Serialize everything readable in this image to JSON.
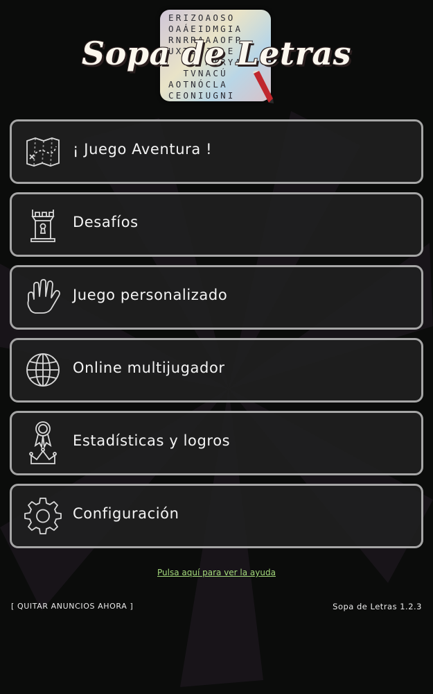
{
  "logo": {
    "grid_rows": [
      "ERIZOAOSO",
      "OAÁEIDMGIA",
      "RNRRAAAOFP",
      "UXTBVJ  E",
      "  T  MTRYA",
      "  TVNACÚ",
      "AOTNÓCLA",
      "CEONIUGNI"
    ],
    "title": "Sopa de Letras"
  },
  "menu": {
    "items": [
      {
        "label": "¡ Juego Aventura !",
        "icon": "map-icon"
      },
      {
        "label": "Desafíos",
        "icon": "tower-icon"
      },
      {
        "label": "Juego personalizado",
        "icon": "hand-icon"
      },
      {
        "label": "Online multijugador",
        "icon": "globe-icon"
      },
      {
        "label": "Estadísticas y logros",
        "icon": "medal-crown-icon"
      },
      {
        "label": "Configuración",
        "icon": "gear-icon"
      }
    ]
  },
  "footer": {
    "help_link": "Pulsa aquí para ver la ayuda",
    "remove_ads": "[ QUITAR ANUNCIOS AHORA ]",
    "version": "Sopa de Letras 1.2.3"
  },
  "colors": {
    "background": "#0b0c0b",
    "button_border": "#a6a6a6",
    "button_fill": "#202020",
    "link": "#a4d97c"
  }
}
